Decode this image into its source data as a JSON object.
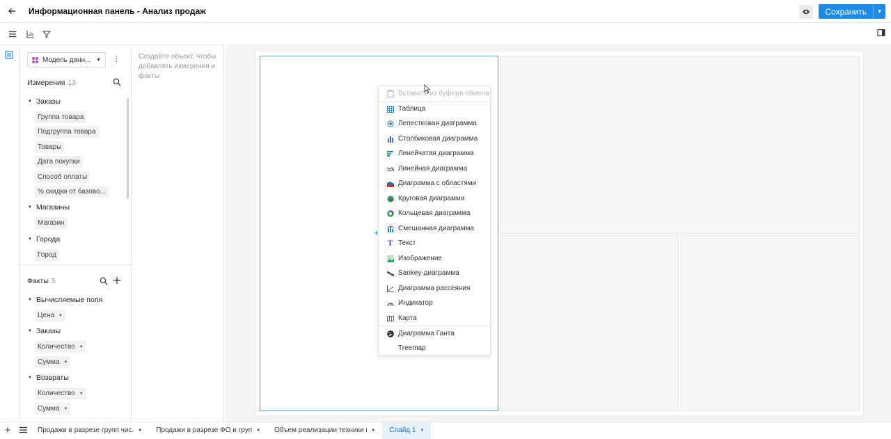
{
  "header": {
    "title": "Информационная панель - Анализ продаж",
    "save_label": "Сохранить"
  },
  "model": {
    "select_label": "Модель данн..."
  },
  "dimensions": {
    "title": "Измерения",
    "count": "13",
    "groups": [
      {
        "label": "Заказы",
        "items": [
          "Группа товара",
          "Подгруппа товара",
          "Товары",
          "Дата покупки",
          "Способ оплаты",
          "% скидки от базово..."
        ]
      },
      {
        "label": "Магазины",
        "items": [
          "Магазин"
        ]
      },
      {
        "label": "Города",
        "items": [
          "Город"
        ]
      }
    ]
  },
  "facts": {
    "title": "Факты",
    "count": "5",
    "groups": [
      {
        "label": "Вычисляемые поля",
        "items": [
          "Цена"
        ]
      },
      {
        "label": "Заказы",
        "items": [
          "Количество",
          "Сумма"
        ]
      },
      {
        "label": "Возвраты",
        "items": [
          "Количество",
          "Сумма"
        ]
      }
    ]
  },
  "hint": "Создайте объект, чтобы добавлять измерения и факты",
  "menu": {
    "paste": "Вставить из буфера обмена",
    "items": [
      {
        "label": "Таблица",
        "icon": "table-icon",
        "color": "#1f8ae6"
      },
      {
        "label": "Лепестковая диаграмма",
        "icon": "radar-icon",
        "color": "#1f6fbf"
      },
      {
        "label": "Столбиковая диаграмма",
        "icon": "bar-chart-icon",
        "color": "#7b3fb5"
      },
      {
        "label": "Линейчатая диаграмма",
        "icon": "hbar-chart-icon",
        "color": "#2e9b5a"
      },
      {
        "label": "Линейная диаграмма",
        "icon": "line-chart-icon",
        "color": "#1f6fbf"
      },
      {
        "label": "Диаграмма с областями",
        "icon": "area-chart-icon",
        "color": "#c0392b"
      },
      {
        "label": "Круговая диаграмма",
        "icon": "pie-chart-icon",
        "color": "#2e9b5a"
      },
      {
        "label": "Кольцевая диаграмма",
        "icon": "donut-chart-icon",
        "color": "#2e9b5a"
      },
      {
        "label": "Смешанная диаграмма",
        "icon": "mixed-chart-icon",
        "color": "#1f8ae6"
      },
      {
        "label": "Текст",
        "icon": "text-icon",
        "color": "#7b3fb5"
      },
      {
        "label": "Изображение",
        "icon": "image-icon",
        "color": "#2e9b5a"
      },
      {
        "label": "Sankey-диаграмма",
        "icon": "sankey-icon",
        "color": "#555555"
      },
      {
        "label": "Диаграмма рассеяния",
        "icon": "scatter-icon",
        "color": "#555555"
      },
      {
        "label": "Индикатор",
        "icon": "indicator-icon",
        "color": "#555555"
      },
      {
        "label": "Карта",
        "icon": "map-icon",
        "color": "#555555"
      }
    ],
    "extra": [
      {
        "label": "Диаграмма Ганта",
        "icon": "gantt-icon",
        "color": "#222222"
      },
      {
        "label": "Treemap",
        "icon": "",
        "color": "#222222"
      }
    ]
  },
  "tabs": [
    {
      "label": "Продажи в разрезе групп чис.",
      "active": false
    },
    {
      "label": "Продажи в разрезе ФО и груп",
      "active": false
    },
    {
      "label": "Объем реализации техники по",
      "active": false
    },
    {
      "label": "Слайд 1",
      "active": true
    }
  ],
  "colors": {
    "accent": "#1f8ae6",
    "active_tab_bg": "#e7f1fb"
  }
}
